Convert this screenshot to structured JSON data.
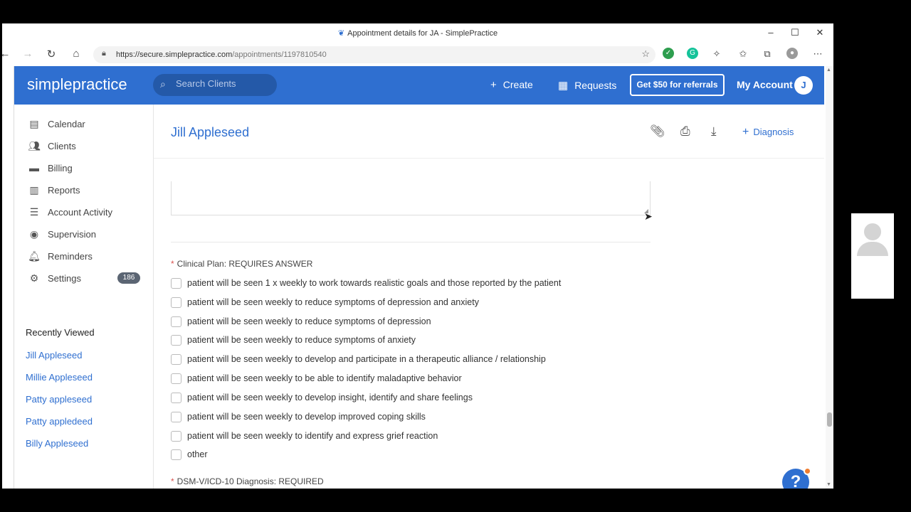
{
  "browser": {
    "window_title": "Appointment details for JA - SimplePractice",
    "url_base": "https://secure.simplepractice.com",
    "url_path": "/appointments/1197810540"
  },
  "header": {
    "logo_simple": "simple",
    "logo_practice": "practice",
    "search_placeholder": "Search Clients",
    "create_label": "Create",
    "requests_label": "Requests",
    "referral_label": "Get $50 for referrals",
    "account_label": "My Account",
    "avatar_initial": "J"
  },
  "sidebar": {
    "items": [
      {
        "label": "Calendar",
        "icon": "calendar-icon"
      },
      {
        "label": "Clients",
        "icon": "clients-icon"
      },
      {
        "label": "Billing",
        "icon": "billing-icon"
      },
      {
        "label": "Reports",
        "icon": "reports-icon"
      },
      {
        "label": "Account Activity",
        "icon": "list-icon"
      },
      {
        "label": "Supervision",
        "icon": "eye-icon"
      },
      {
        "label": "Reminders",
        "icon": "bell-icon"
      },
      {
        "label": "Settings",
        "icon": "gear-icon"
      }
    ],
    "reminders_count": "186",
    "recently_viewed_title": "Recently Viewed",
    "recently_viewed": [
      "Jill Appleseed",
      "Millie Appleseed",
      "Patty appleseed",
      "Patty appledeed",
      "Billy Appleseed"
    ]
  },
  "main": {
    "client_name": "Jill Appleseed",
    "diagnosis_label": "Diagnosis",
    "clinical_plan_label": "Clinical Plan: REQUIRES ANSWER",
    "clinical_plan_options": [
      "patient will be seen 1 x weekly to work towards realistic goals and those reported by the patient",
      "patient will be seen weekly to reduce symptoms of depression and anxiety",
      "patient will be seen weekly to reduce symptoms of depression",
      "patient will be seen weekly to reduce symptoms of anxiety",
      "patient will be seen weekly to develop and participate in a therapeutic alliance / relationship",
      "patient will be seen weekly to be able to identify maladaptive behavior",
      "patient will be seen weekly to develop insight, identify and share feelings",
      "patient will be seen weekly to develop improved coping skills",
      "patient will be seen weekly to identify and express grief reaction",
      "other"
    ],
    "dsm_label": "DSM-V/ICD-10 Diagnosis: REQUIRED"
  },
  "colors": {
    "brand_blue": "#2f6fd0",
    "required_star": "#d9534f",
    "help_dot": "#f07d2f"
  }
}
